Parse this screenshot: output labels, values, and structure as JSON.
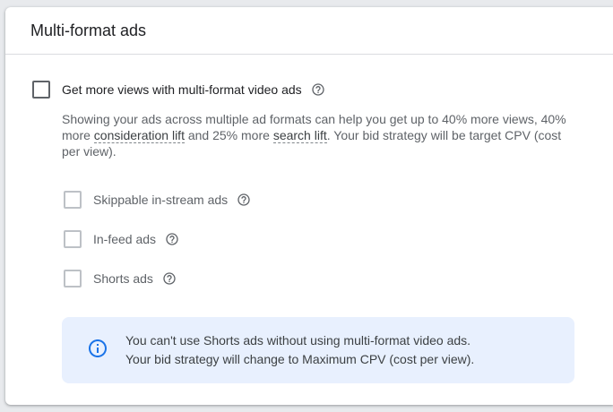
{
  "card": {
    "title": "Multi-format ads"
  },
  "main_option": {
    "label": "Get more views with multi-format video ads",
    "checked": false,
    "help_icon": "help-circle-icon"
  },
  "description": {
    "part1": "Showing your ads across multiple ad formats can help you get up to 40% more views, 40% more ",
    "link1": "consideration lift",
    "part2": " and 25% more ",
    "link2": "search lift",
    "part3": ". Your bid strategy will be target CPV (cost per view)."
  },
  "sub_options": [
    {
      "label": "Skippable in-stream ads",
      "checked": false,
      "disabled": true
    },
    {
      "label": "In-feed ads",
      "checked": false,
      "disabled": true
    },
    {
      "label": "Shorts ads",
      "checked": false,
      "disabled": true
    }
  ],
  "info": {
    "icon": "info-icon",
    "line1": "You can't use Shorts ads without using multi-format video ads.",
    "line2": "Your bid strategy will change to Maximum CPV (cost per view)."
  },
  "colors": {
    "info_icon": "#1a73e8",
    "info_bg": "#e8f0fe"
  }
}
